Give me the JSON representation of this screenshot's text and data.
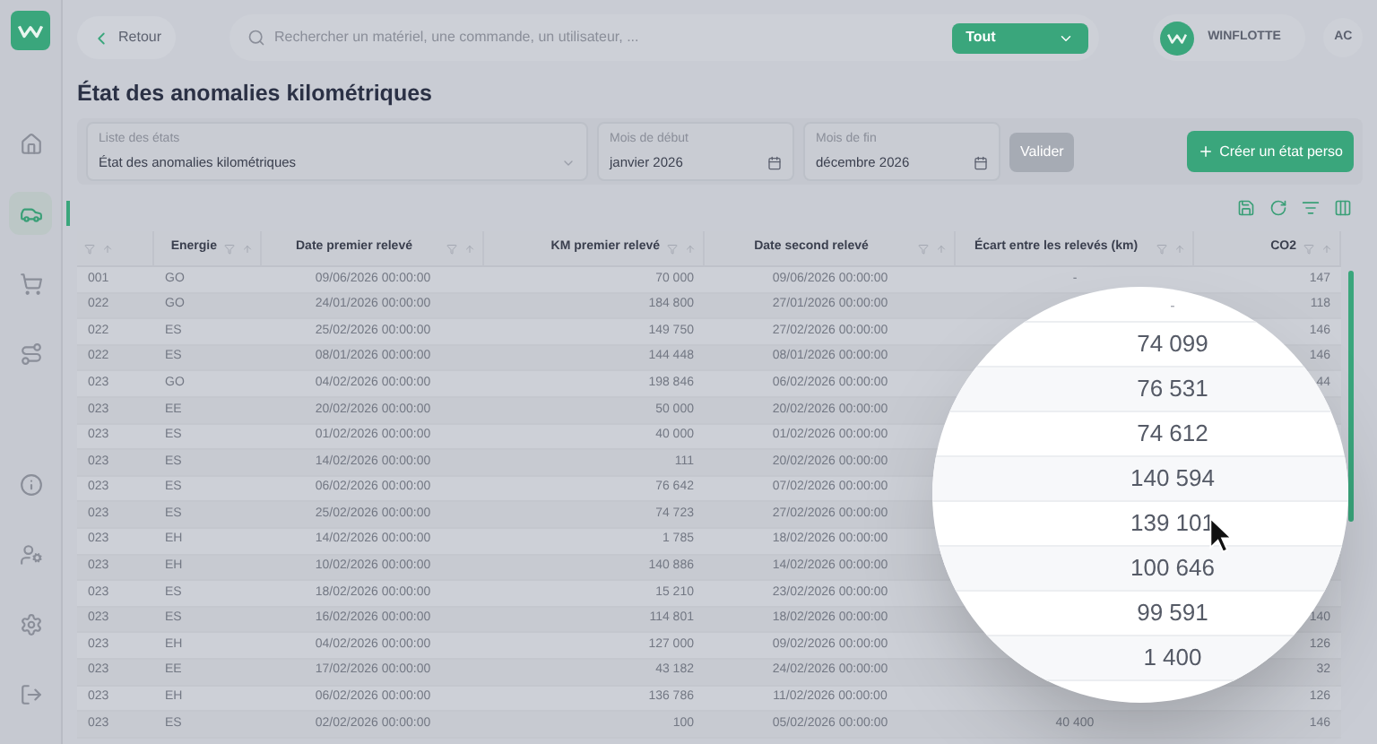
{
  "topbar": {
    "back": "Retour",
    "search": {
      "placeholder": "Rechercher un matériel, une commande, un utilisateur, ..."
    },
    "scope": "Tout",
    "company": "WINFLOTTE",
    "avatar": "AC"
  },
  "sidebar": {
    "items": [
      {
        "kind": "home",
        "selected": false
      },
      {
        "kind": "car",
        "selected": true
      },
      {
        "kind": "cart",
        "selected": false
      },
      {
        "kind": "route",
        "selected": false
      },
      {
        "kind": "info",
        "selected": false
      },
      {
        "kind": "user",
        "selected": false
      },
      {
        "kind": "settings",
        "selected": false
      },
      {
        "kind": "logout",
        "selected": false
      }
    ]
  },
  "title": "État des anomalies kilométriques",
  "filters": {
    "list": {
      "label": "Liste des états",
      "value": "État des anomalies kilométriques"
    },
    "start": {
      "label": "Mois de début",
      "value": "janvier 2026"
    },
    "end": {
      "label": "Mois de fin",
      "value": "décembre 2026"
    },
    "validate": {
      "label": "Valider",
      "disabled": true
    },
    "create": "Créer un état perso"
  },
  "table": {
    "columns": [
      {},
      {
        "label": "Energie"
      },
      {
        "label": "Date premier relevé"
      },
      {
        "label": "KM premier relevé"
      },
      {
        "label": "Date second relevé"
      },
      {
        "label": "Écart entre les relevés (km)"
      },
      {
        "label": "CO2"
      }
    ],
    "rows": [
      [
        "001",
        "GO",
        "09/06/2026 00:00:00",
        "70 000",
        "09/06/2026 00:00:00",
        "-",
        "147"
      ],
      [
        "022",
        "GO",
        "24/01/2026 00:00:00",
        "184 800",
        "27/01/2026 00:00:00",
        null,
        "118"
      ],
      [
        "022",
        "ES",
        "25/02/2026 00:00:00",
        "149 750",
        "27/02/2026 00:00:00",
        null,
        "146"
      ],
      [
        "022",
        "ES",
        "08/01/2026 00:00:00",
        "144 448",
        "08/01/2026 00:00:00",
        null,
        "146"
      ],
      [
        "023",
        "GO",
        "04/02/2026 00:00:00",
        "198 846",
        "06/02/2026 00:00:00",
        null,
        "44"
      ],
      [
        "023",
        "EE",
        "20/02/2026 00:00:00",
        "50 000",
        "20/02/2026 00:00:00",
        null,
        null
      ],
      [
        "023",
        "ES",
        "01/02/2026 00:00:00",
        "40 000",
        "01/02/2026 00:00:00",
        null,
        null
      ],
      [
        "023",
        "ES",
        "14/02/2026 00:00:00",
        "111",
        "20/02/2026 00:00:00",
        null,
        null
      ],
      [
        "023",
        "ES",
        "06/02/2026 00:00:00",
        "76 642",
        "07/02/2026 00:00:00",
        null,
        null
      ],
      [
        "023",
        "ES",
        "25/02/2026 00:00:00",
        "74 723",
        "27/02/2026 00:00:00",
        null,
        null
      ],
      [
        "023",
        "EH",
        "14/02/2026 00:00:00",
        "1 785",
        "18/02/2026 00:00:00",
        null,
        null
      ],
      [
        "023",
        "EH",
        "10/02/2026 00:00:00",
        "140 886",
        "14/02/2026 00:00:00",
        null,
        null
      ],
      [
        "023",
        "ES",
        "18/02/2026 00:00:00",
        "15 210",
        "23/02/2026 00:00:00",
        null,
        null
      ],
      [
        "023",
        "ES",
        "16/02/2026 00:00:00",
        "114 801",
        "18/02/2026 00:00:00",
        null,
        "140"
      ],
      [
        "023",
        "EH",
        "04/02/2026 00:00:00",
        "127 000",
        "09/02/2026 00:00:00",
        null,
        "126"
      ],
      [
        "023",
        "EE",
        "17/02/2026 00:00:00",
        "43 182",
        "24/02/2026 00:00:00",
        null,
        "32"
      ],
      [
        "023",
        "EH",
        "06/02/2026 00:00:00",
        "136 786",
        "11/02/2026 00:00:00",
        null,
        "126"
      ],
      [
        "023",
        "ES",
        "02/02/2026 00:00:00",
        "100",
        "05/02/2026 00:00:00",
        "40 400",
        "146"
      ]
    ]
  },
  "magnifier": {
    "values": [
      "-",
      "74 099",
      "76 531",
      "74 612",
      "140 594",
      "139 101",
      "100 646",
      "99 591",
      "1 400"
    ]
  }
}
